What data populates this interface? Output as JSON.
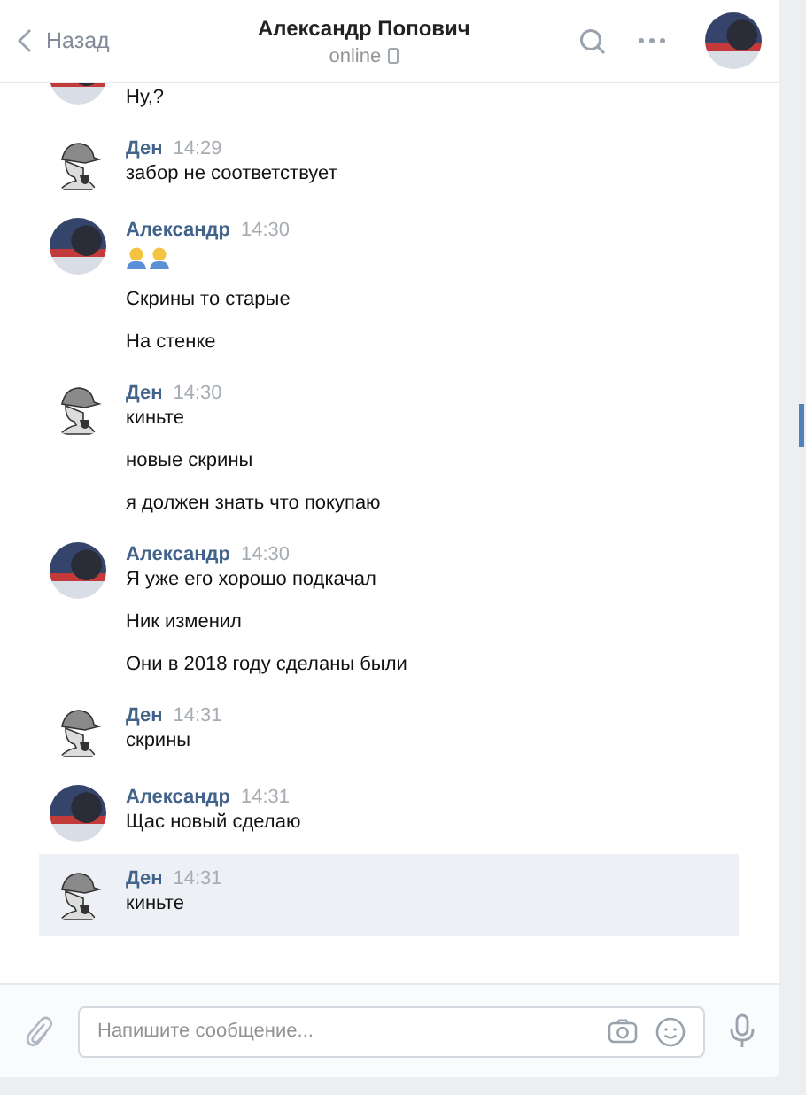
{
  "header": {
    "back_label": "Назад",
    "title": "Александр Попович",
    "status": "online"
  },
  "groups": [
    {
      "kind": "alex",
      "selected": false,
      "messages": [
        {
          "kind": "text",
          "text": "Ну,?"
        }
      ]
    },
    {
      "kind": "den",
      "name": "Ден",
      "time": "14:29",
      "selected": false,
      "messages": [
        {
          "kind": "text",
          "text": "забор не соответствует"
        }
      ]
    },
    {
      "kind": "alex",
      "name": "Александр",
      "time": "14:30",
      "selected": false,
      "messages": [
        {
          "kind": "emoji"
        },
        {
          "kind": "text",
          "text": "Скрины то старые"
        },
        {
          "kind": "text",
          "text": "На стенке"
        }
      ]
    },
    {
      "kind": "den",
      "name": "Ден",
      "time": "14:30",
      "selected": false,
      "messages": [
        {
          "kind": "text",
          "text": "киньте"
        },
        {
          "kind": "text",
          "text": "новые скрины"
        },
        {
          "kind": "text",
          "text": "я должен знать что покупаю"
        }
      ]
    },
    {
      "kind": "alex",
      "name": "Александр",
      "time": "14:30",
      "selected": false,
      "messages": [
        {
          "kind": "text",
          "text": "Я уже его хорошо подкачал"
        },
        {
          "kind": "text",
          "text": "Ник изменил"
        },
        {
          "kind": "text",
          "text": "Они в 2018 году сделаны были"
        }
      ]
    },
    {
      "kind": "den",
      "name": "Ден",
      "time": "14:31",
      "selected": false,
      "messages": [
        {
          "kind": "text",
          "text": "скрины"
        }
      ]
    },
    {
      "kind": "alex",
      "name": "Александр",
      "time": "14:31",
      "selected": false,
      "messages": [
        {
          "kind": "text",
          "text": "Щас новый сделаю"
        }
      ]
    },
    {
      "kind": "den",
      "name": "Ден",
      "time": "14:31",
      "selected": true,
      "messages": [
        {
          "kind": "text",
          "text": "киньте"
        }
      ]
    }
  ],
  "composer": {
    "placeholder": "Напишите сообщение..."
  }
}
